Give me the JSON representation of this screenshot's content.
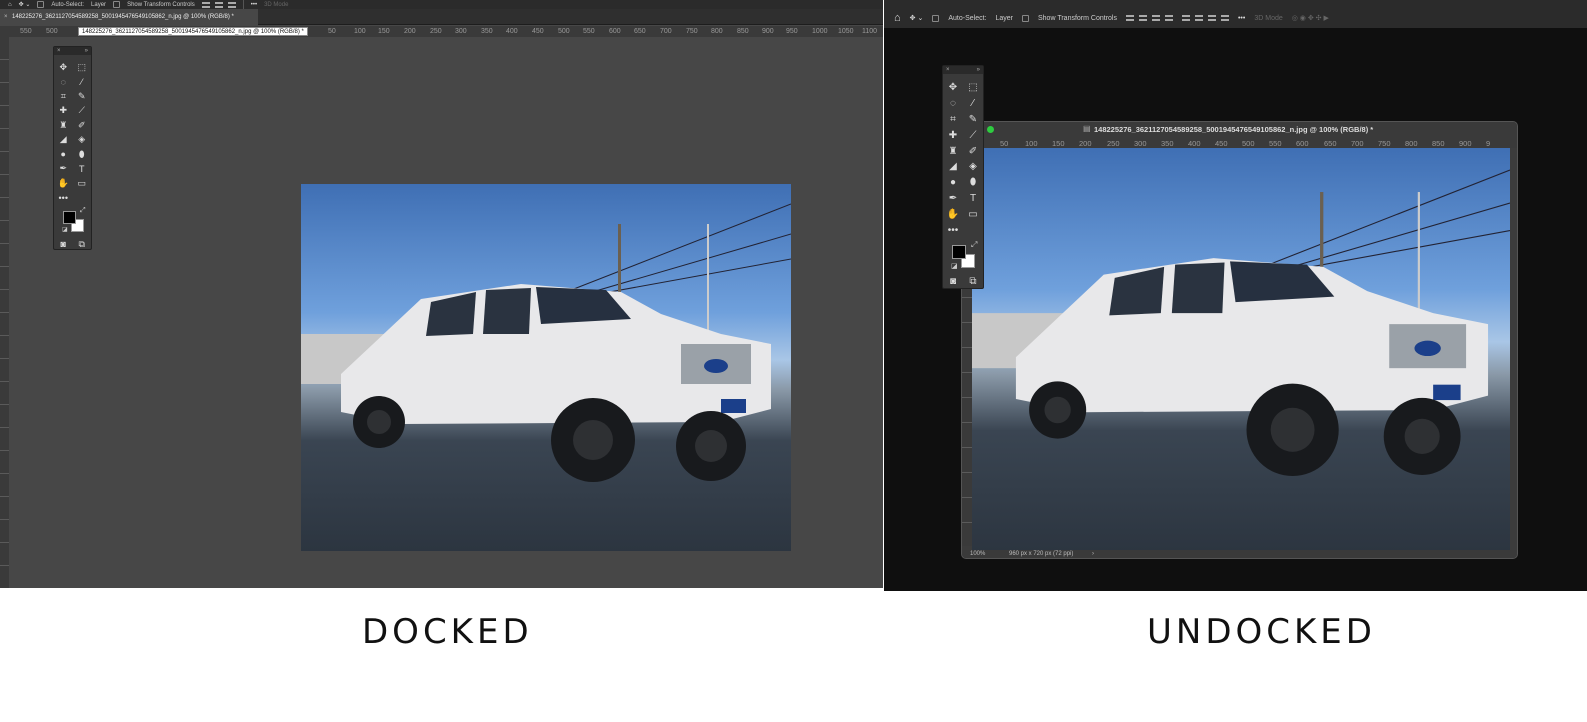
{
  "docked": {
    "options_bar": {
      "auto_select_label": "Auto-Select:",
      "layer_select": "Layer",
      "show_transform_label": "Show Transform Controls",
      "mode_3d": "3D Mode"
    },
    "tab_title": "148225276_3621127054589258_5001945476549105862_n.jpg @ 100% (RGB/8) *",
    "tooltip": "148225276_3621127054589258_5001945476549105862_n.jpg @ 100% (RGB/8) *",
    "ruler_ticks": [
      "550",
      "500",
      "50",
      "100",
      "150",
      "200",
      "250",
      "300",
      "350",
      "400",
      "450",
      "500",
      "550",
      "600",
      "650",
      "700",
      "750",
      "800",
      "850",
      "900",
      "950",
      "1000",
      "1050",
      "1100"
    ]
  },
  "undocked": {
    "options_bar": {
      "auto_select_label": "Auto-Select:",
      "layer_select": "Layer",
      "show_transform_label": "Show Transform Controls",
      "mode_3d": "3D Mode"
    },
    "doc_title": "148225276_3621127054589258_5001945476549105862_n.jpg @ 100% (RGB/8) *",
    "ruler_ticks": [
      "50",
      "100",
      "150",
      "200",
      "250",
      "300",
      "350",
      "400",
      "450",
      "500",
      "550",
      "600",
      "650",
      "700",
      "750",
      "800",
      "850",
      "900",
      "9"
    ],
    "status_zoom": "100%",
    "status_info": "960 px x 720 px (72 ppi)"
  },
  "labels": {
    "docked": "DOCKED",
    "undocked": "UNDOCKED"
  },
  "colors": {
    "docked_canvas": "#474747",
    "undocked_canvas": "#0f0f0f",
    "ui_dark": "#2b2b2b",
    "traffic_green": "#2ecc40"
  },
  "icons": [
    "home-icon",
    "move-icon",
    "marquee-icon",
    "lasso-icon",
    "quick-select-icon",
    "crop-icon",
    "eyedropper-icon",
    "healing-icon",
    "brush-icon",
    "stamp-icon",
    "history-brush-icon",
    "eraser-icon",
    "paint-bucket-icon",
    "blur-icon",
    "dodge-icon",
    "pen-icon",
    "type-icon",
    "hand-icon",
    "rectangle-icon",
    "more-tools-icon",
    "quick-mask-icon",
    "screen-mode-icon",
    "document-icon"
  ]
}
